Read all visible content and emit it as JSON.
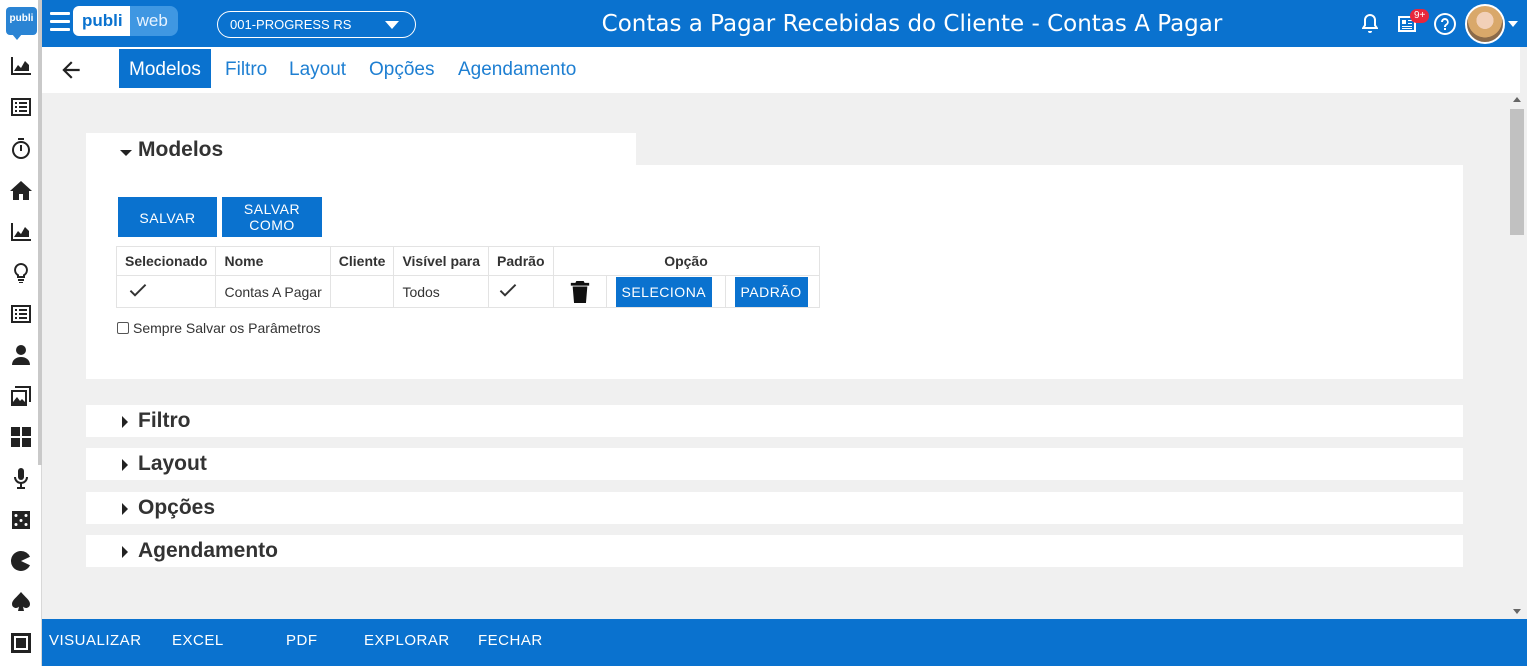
{
  "brand": {
    "logo_small": "publi",
    "part1": "publi",
    "part2": "web"
  },
  "header": {
    "company": "001-PROGRESS RS",
    "title": "Contas a Pagar Recebidas do Cliente - Contas A Pagar",
    "notification_badge": "9+"
  },
  "sidebar": {
    "icons": [
      "area-chart-icon",
      "list-icon",
      "stopwatch-icon",
      "home-icon",
      "area-chart-icon",
      "lightbulb-icon",
      "list-icon",
      "user-tie-icon",
      "photo-gallery-icon",
      "cmyk-icon",
      "microphone-icon",
      "dice-icon",
      "pacman-icon",
      "spade-icon",
      "square-icon"
    ]
  },
  "tabs": [
    {
      "label": "Modelos",
      "active": true
    },
    {
      "label": "Filtro",
      "active": false
    },
    {
      "label": "Layout",
      "active": false
    },
    {
      "label": "Opções",
      "active": false
    },
    {
      "label": "Agendamento",
      "active": false
    }
  ],
  "modelos": {
    "title": "Modelos",
    "save_label": "SALVAR",
    "save_as_label": "SALVAR COMO",
    "columns": [
      "Selecionado",
      "Nome",
      "Cliente",
      "Visível para",
      "Padrão",
      "Opção"
    ],
    "rows": [
      {
        "selected": true,
        "nome": "Contas A Pagar",
        "cliente": "",
        "visivel": "Todos",
        "padrao": true,
        "select_label": "SELECIONA",
        "default_label": "PADRÃO"
      }
    ],
    "always_save_label": "Sempre Salvar os Parâmetros"
  },
  "sections": {
    "filtro": "Filtro",
    "layout": "Layout",
    "opcoes": "Opções",
    "agendamento": "Agendamento"
  },
  "footer": {
    "visualizar": "VISUALIZAR",
    "excel": "EXCEL",
    "pdf": "PDF",
    "explorar": "EXPLORAR",
    "fechar": "FECHAR"
  },
  "colors": {
    "primary": "#0a72cf",
    "link": "#1e7fd2",
    "badge": "#e8263c"
  }
}
